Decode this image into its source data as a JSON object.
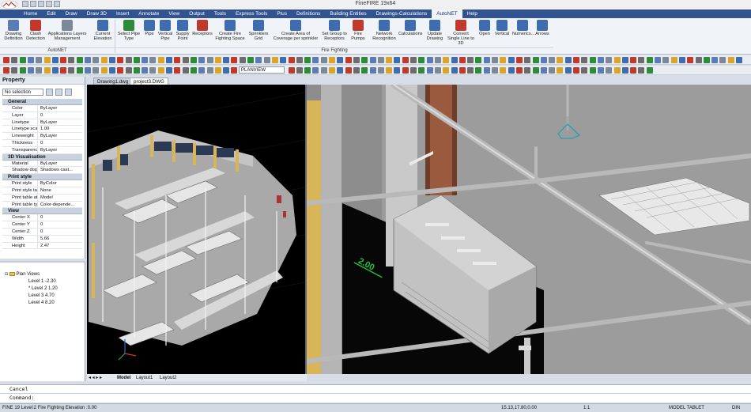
{
  "title": "FineFIRE 19x64",
  "menu": [
    "Home",
    "Edit",
    "Draw",
    "Draw 3D",
    "Insert",
    "Annotate",
    "View",
    "Output",
    "Tools",
    "Express Tools",
    "Plus",
    "Definitions",
    "Building Entities",
    "Drawings-Calculations",
    "AutoNET",
    "Help"
  ],
  "active_menu": "AutoNET",
  "ribbon": {
    "buttons": [
      {
        "id": "drawing-definition",
        "label": "Drawing Definition",
        "color": "#5b7bb5"
      },
      {
        "id": "clash-detection",
        "label": "Clash Detection",
        "color": "#c0392b"
      },
      {
        "id": "applications-layers",
        "label": "Applications Layers Management",
        "color": "#7d8896"
      },
      {
        "id": "current-elevation",
        "label": "Current Elevation",
        "color": "#3d6db0"
      },
      {
        "id": "select-pipe-type",
        "label": "Select Pipe Type",
        "color": "#2e8b3a"
      },
      {
        "id": "pipe",
        "label": "Pipe",
        "color": "#3d6db0"
      },
      {
        "id": "vertical-pipe",
        "label": "Vertical Pipe",
        "color": "#3d6db0"
      },
      {
        "id": "supply-point",
        "label": "Supply Point",
        "color": "#3d6db0"
      },
      {
        "id": "receptors",
        "label": "Receptors",
        "color": "#c0392b"
      },
      {
        "id": "create-fire-fighting-space",
        "label": "Create Fire Fighting Space",
        "color": "#3d6db0"
      },
      {
        "id": "sprinklers-grid",
        "label": "Sprinklers Grid",
        "color": "#3d6db0"
      },
      {
        "id": "create-area-coverage",
        "label": "Create Area of Coverage per sprinkler",
        "color": "#3d6db0"
      },
      {
        "id": "set-group-receptors",
        "label": "Set Group to Receptors",
        "color": "#3d6db0"
      },
      {
        "id": "fire-pumps",
        "label": "Fire Pumps",
        "color": "#c0392b"
      },
      {
        "id": "network-recognition",
        "label": "Network Recognition",
        "color": "#3d6db0"
      },
      {
        "id": "calculations",
        "label": "Calculations",
        "color": "#3d6db0"
      },
      {
        "id": "update-drawing",
        "label": "Update Drawing",
        "color": "#3d6db0"
      },
      {
        "id": "convert-single-line",
        "label": "Convert Single Line to 3D",
        "color": "#c0392b"
      },
      {
        "id": "open",
        "label": "Open",
        "color": "#3d6db0"
      },
      {
        "id": "vertical",
        "label": "Vertical",
        "color": "#3d6db0"
      },
      {
        "id": "numerics",
        "label": "Numerics...",
        "color": "#3d6db0"
      },
      {
        "id": "arrows",
        "label": "Arrows",
        "color": "#3d6db0"
      }
    ],
    "groups": {
      "autonet": "AutoNET",
      "fire_fighting": "Fire Fighting"
    }
  },
  "toolbar": {
    "view_select": "PLANVIEW"
  },
  "property_panel": {
    "title": "Property",
    "selection": "No selection",
    "sections": [
      {
        "name": "General",
        "rows": [
          [
            "Color",
            "ByLayer"
          ],
          [
            "Layer",
            "0"
          ],
          [
            "Linetype",
            "ByLayer"
          ],
          [
            "Linetype scale",
            "1.00"
          ],
          [
            "Lineweight",
            "ByLayer"
          ],
          [
            "Thickness",
            "0"
          ],
          [
            "Transparency",
            "ByLayer"
          ]
        ]
      },
      {
        "name": "3D Visualisation",
        "rows": [
          [
            "Material",
            "ByLayer"
          ],
          [
            "Shadow display",
            "Shadows cast..."
          ]
        ]
      },
      {
        "name": "Print style",
        "rows": [
          [
            "Print style",
            "ByColor"
          ],
          [
            "Print style table",
            "None"
          ],
          [
            "Print table atta...",
            "Model"
          ],
          [
            "Print table type",
            "Color-depende..."
          ]
        ]
      },
      {
        "name": "View",
        "rows": [
          [
            "Center X",
            "0"
          ],
          [
            "Center Y",
            "0"
          ],
          [
            "Center Z",
            "0"
          ],
          [
            "Width",
            "5.66"
          ],
          [
            "Height",
            "2.47"
          ]
        ]
      }
    ]
  },
  "tree": {
    "root": "Plan Views",
    "levels": [
      "Level 1 -2.30",
      "* Level 2 1.20",
      "Level 3 4.70",
      "Level 4 8.20"
    ]
  },
  "doc_tabs": [
    "Drawing1.dwg",
    "project3.DWG"
  ],
  "active_doc": "project3.DWG",
  "layout_tabs": [
    "Model",
    "Layout1",
    "Layout2"
  ],
  "command": {
    "history": "Cancel",
    "prompt": "Command:"
  },
  "status": {
    "left": "FINE 19 Level:2 Fire Fighting Elevation :0.00",
    "coords": "15.13,17.80,0.00",
    "right": "MODEL TABLET",
    "scale": "1:1",
    "lang": "DIN"
  },
  "viewport_label": "2.00"
}
